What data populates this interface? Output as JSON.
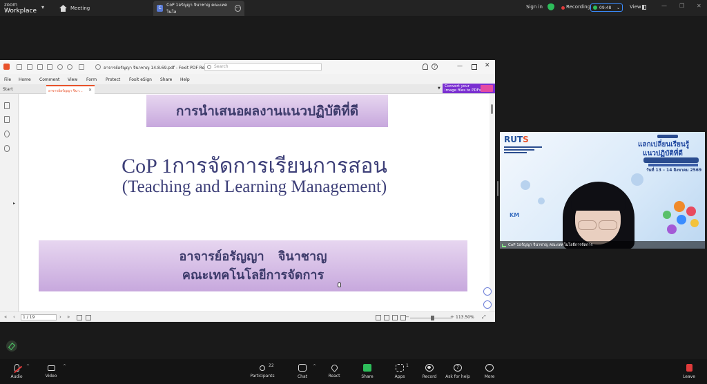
{
  "zoom": {
    "brand_line1": "zoom",
    "brand_line2": "Workplace",
    "meeting_tab": "Meeting",
    "share_tab_title": "CoP 1อรัญญา จินาชาญ คณะเทคโนโล",
    "sign_in": "Sign in",
    "recording_label": "Recording",
    "timer": "09:48",
    "view_label": "View",
    "colors": {
      "accent": "#3a8cff",
      "recording": "#e03b3b",
      "secure": "#2dbd5a"
    }
  },
  "foxit": {
    "doc_title": "อาจารย์อรัญญา  จินาชาญ 14.8.69.pdf - Foxit PDF Reader",
    "search_placeholder": "Search",
    "menu": [
      "File",
      "Home",
      "Comment",
      "View",
      "Form",
      "Protect",
      "Foxit eSign",
      "Share",
      "Help"
    ],
    "tab_start": "Start",
    "tab_doc": "อาจารย์อรัญญา  จินา...",
    "ad_line1": "Convert your",
    "ad_line2": "image files to PDFs",
    "page_indicator": "1 / 19",
    "zoom_level": "113.50%"
  },
  "slide": {
    "banner_top": "การนำเสนอผลงานแนวปฏิบัติที่ดี",
    "title": "CoP 1การจัดการเรียนการสอน",
    "subtitle": "(Teaching and Learning Management)",
    "presenter": "อาจารย์อรัญญา  จินาชาญ",
    "faculty": "คณะเทคโนโลยีการจัดการ"
  },
  "video": {
    "logo_text": "RUT",
    "logo_accent": "S",
    "headline1": "แลกเปลี่ยนเรียนรู้",
    "headline2": "แนวปฏิบัติที่ดี",
    "event_date": "วันที่ 13 – 14 สิงหาคม 2569",
    "km_label": "KM",
    "participant_name": "CoP 1อรัญญา จินาชาญ คณะเทคโนโลยีการจัดการ"
  },
  "toolbar": {
    "audio": "Audio",
    "video": "Video",
    "participants": "Participants",
    "participants_count": "22",
    "chat": "Chat",
    "react": "React",
    "share": "Share",
    "apps": "Apps",
    "apps_count": "1",
    "record": "Record",
    "help": "Ask for help",
    "more": "More",
    "leave": "Leave"
  }
}
